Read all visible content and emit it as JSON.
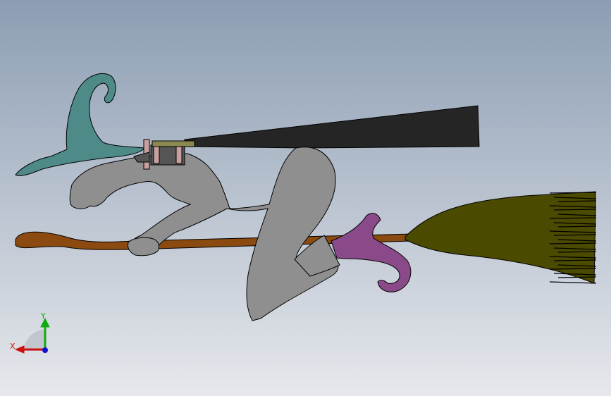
{
  "viewport": {
    "background_top": "#8c9db3",
    "background_bottom": "#e6e8ec"
  },
  "model": {
    "colors": {
      "hat": "#4d8a88",
      "body": "#8f8f8f",
      "cape": "#252525",
      "broom_handle": "#8a4a10",
      "bristles": "#4a4a00",
      "boot": "#8a4a8a",
      "band": "#c8a0a0",
      "outline": "#000000"
    }
  },
  "triad": {
    "x_label": "X",
    "y_label": "Y",
    "x_color": "#cc1111",
    "y_color": "#11aa11",
    "z_color": "#1111cc"
  }
}
